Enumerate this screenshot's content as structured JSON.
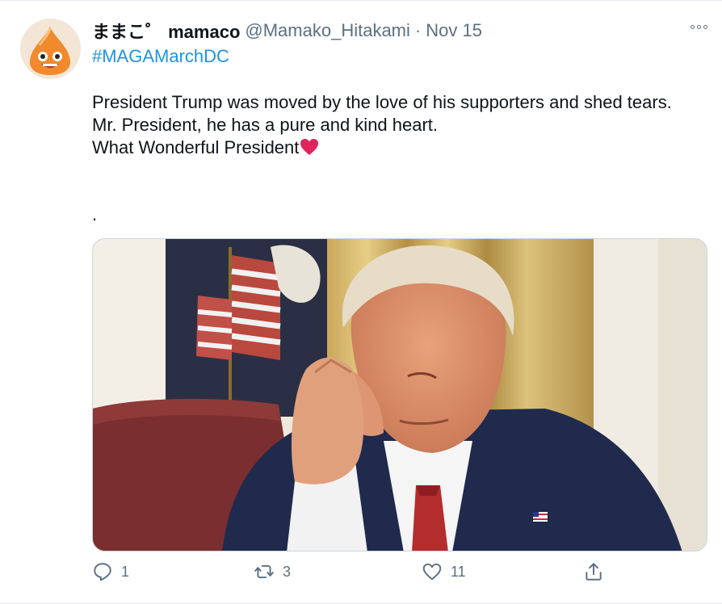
{
  "tweet": {
    "display_name": "ままこ゜ mamaco",
    "handle": "@Mamako_Hitakami",
    "separator": "·",
    "date": "Nov 15",
    "hashtag": "#MAGAMarchDC",
    "text_lines": [
      "President Trump was moved by the love of his supporters and shed tears.",
      "Mr. President, he has a pure and kind heart.",
      "What Wonderful President"
    ],
    "trailing_dot": ".",
    "avatar_icon": "slime-avatar",
    "media_icon": "photo-of-man-wiping-eye",
    "heart_color": "#e0245e",
    "link_color": "#1b95e0"
  },
  "actions": {
    "reply_count": "1",
    "retweet_count": "3",
    "like_count": "11"
  }
}
